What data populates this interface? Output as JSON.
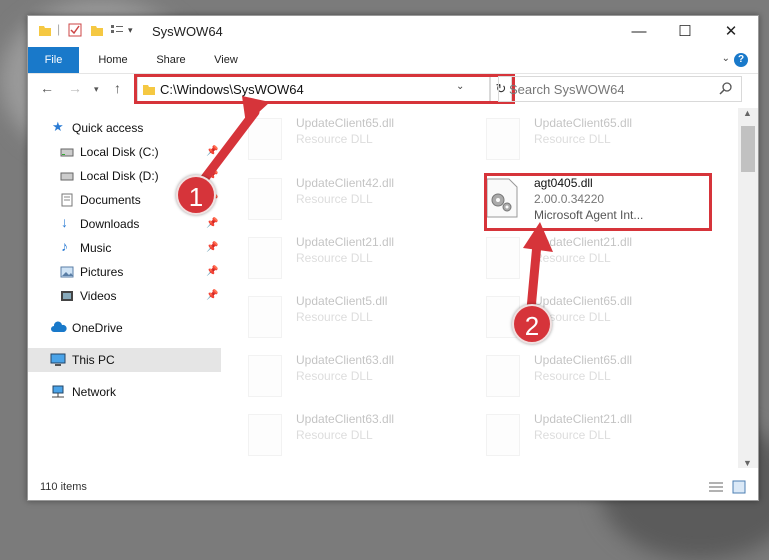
{
  "window": {
    "title": "SysWOW64",
    "controls": {
      "minimize": "—",
      "maximize": "☐",
      "close": "✕"
    }
  },
  "ribbon": {
    "tabs": [
      "File",
      "Home",
      "Share",
      "View"
    ],
    "help": "?"
  },
  "nav": {
    "address": "C:\\Windows\\SysWOW64",
    "search_placeholder": "Search SysWOW64"
  },
  "sidebar": {
    "quick_access": "Quick access",
    "items": [
      "Local Disk (C:)",
      "Local Disk (D:)",
      "Documents",
      "Downloads",
      "Music",
      "Pictures",
      "Videos"
    ],
    "onedrive": "OneDrive",
    "this_pc": "This PC",
    "network": "Network"
  },
  "files": {
    "left": [
      {
        "name": "UpdateClient65.dll",
        "type": "Resource DLL"
      },
      {
        "name": "UpdateClient42.dll",
        "type": "Resource DLL"
      },
      {
        "name": "UpdateClient21.dll",
        "type": "Resource DLL"
      },
      {
        "name": "UpdateClient5.dll",
        "type": "Resource DLL"
      },
      {
        "name": "UpdateClient63.dll",
        "type": "Resource DLL"
      },
      {
        "name": "UpdateClient63.dll",
        "type": "Resource DLL"
      }
    ],
    "right": [
      {
        "name": "UpdateClient65.dll",
        "type": "Resource DLL"
      },
      {
        "name": "UpdateClient21.dll",
        "type": "Resource DLL"
      },
      {
        "name": "UpdateClient65.dll",
        "type": "Resource DLL"
      },
      {
        "name": "UpdateClient65.dll",
        "type": "Resource DLL"
      },
      {
        "name": "UpdateClient21.dll",
        "type": "Resource DLL"
      }
    ],
    "highlighted": {
      "name": "agt0405.dll",
      "version": "2.00.0.34220",
      "description": "Microsoft Agent Int..."
    }
  },
  "status": {
    "item_count": "110 items"
  },
  "badges": {
    "one": "1",
    "two": "2"
  },
  "colors": {
    "accent": "#1979ca",
    "highlight": "#d6343a"
  }
}
